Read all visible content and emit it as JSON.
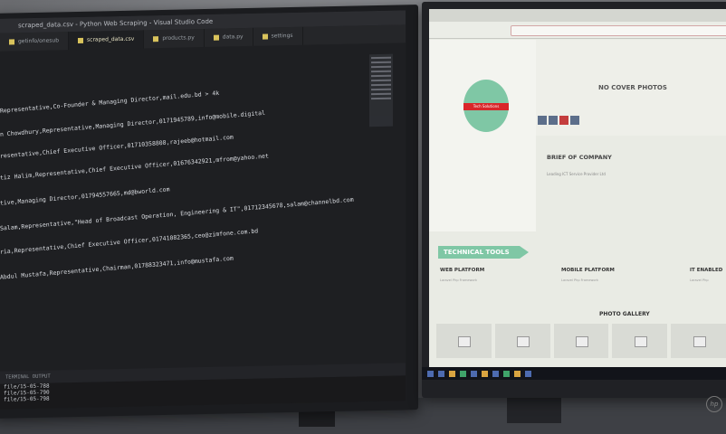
{
  "left_monitor": {
    "window_title": "scraped_data.csv - Python Web Scraping - Visual Studio Code",
    "tabs": [
      {
        "label": "getinfo/onesub",
        "active": false
      },
      {
        "label": "scraped_data.csv",
        "active": true
      },
      {
        "label": "products.py",
        "active": false
      },
      {
        "label": "data.py",
        "active": false
      },
      {
        "label": "settings",
        "active": false
      }
    ],
    "code_lines": [
      "Representative,Co-Founder & Managing Director,mail.edu.bd > 4k",
      "n Chowdhury,Representative,Managing Director,0171945789,info@mobile.digital",
      "resentative,Chief Executive Officer,01710358808,rajeeb@hotmail.com",
      "tiz Halim,Representative,Chief Executive Officer,01676342921,mfrom@yahoo.net",
      "tive,Managing Director,01794557665,md@bworld.com",
      "Salam,Representative,\"Head of Broadcast Operation, Engineering & IT\",01712345678,salam@channelbd.com",
      "ria,Representative,Chief Executive Officer,01741082365,ceo@zimfone.com.bd",
      "Abdul Mustafa,Representative,Chairman,01788323471,info@mustafa.com"
    ],
    "terminal_bar": "TERMINAL   OUTPUT",
    "terminal_lines": [
      "file/15-05-788",
      "file/15-05-790",
      "file/15-05-798"
    ]
  },
  "right_monitor": {
    "cover_text": "NO COVER PHOTOS",
    "avatar_tag": "Tech Solutions",
    "brief_title": "BRIEF OF COMPANY",
    "brief_text": "Leading ICT Service Provider Ltd",
    "tools_banner": "TECHNICAL TOOLS",
    "platforms": [
      {
        "title": "WEB PLATFORM",
        "sub": "Laravel Php Framework"
      },
      {
        "title": "MOBILE PLATFORM",
        "sub": "Laravel Php Framework"
      },
      {
        "title": "IT ENABLED",
        "sub": "Laravel Php"
      }
    ],
    "gallery_title": "PHOTO GALLERY",
    "brand": "hp"
  }
}
